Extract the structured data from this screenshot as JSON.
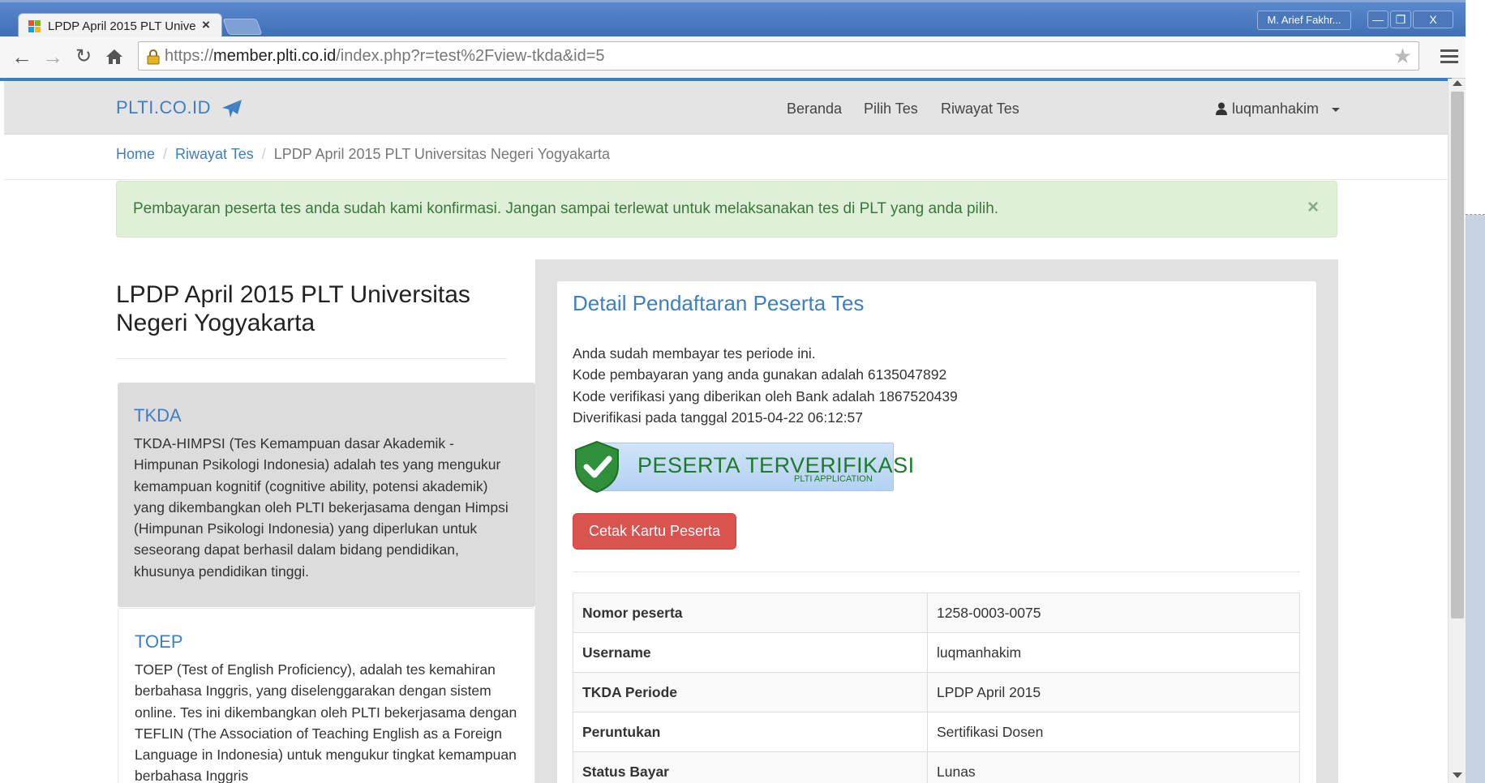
{
  "browser": {
    "tab_title": "LPDP April 2015 PLT Universitas Negeri Yogyakarta",
    "tab_close": "×",
    "user_badge": "M. Arief Fakhr...",
    "win_minimize": "—",
    "win_restore": "❐",
    "win_close": "X",
    "url_scheme": "https://",
    "url_host": "member.plti.co.id",
    "url_path": "/index.php?r=test%2Fview-tkda&id=5",
    "icons": [
      "back-icon",
      "forward-icon",
      "reload-icon",
      "home-icon",
      "lock-icon",
      "star-icon",
      "menu-icon"
    ]
  },
  "navbar": {
    "brand": "PLTI.CO.ID",
    "links": [
      "Beranda",
      "Pilih Tes",
      "Riwayat Tes"
    ],
    "user": "luqmanhakim"
  },
  "breadcrumb": {
    "home": "Home",
    "history": "Riwayat Tes",
    "current": "LPDP April 2015 PLT Universitas Negeri Yogyakarta"
  },
  "alert": {
    "text": "Pembayaran peserta tes anda sudah kami konfirmasi. Jangan sampai terlewat untuk melaksanakan tes di PLT yang anda pilih.",
    "close": "×",
    "color": "#dff0d8"
  },
  "left": {
    "title": "LPDP April 2015 PLT Universitas Negeri Yogyakarta",
    "tkda": {
      "heading": "TKDA",
      "body": "TKDA-HIMPSI (Tes Kemampuan dasar Akademik - Himpunan Psikologi Indonesia) adalah tes yang mengukur kemampuan kognitif (cognitive ability, potensi akademik) yang dikembangkan oleh PLTI bekerjasama dengan Himpsi (Himpunan Psikologi Indonesia) yang diperlukan untuk seseorang dapat berhasil dalam bidang pendidikan, khusunya pendidikan tinggi."
    },
    "toep": {
      "heading": "TOEP",
      "body": "TOEP (Test of English Proficiency), adalah tes kemahiran berbahasa Inggris, yang diselenggarakan dengan sistem online. Tes ini dikembangkan oleh PLTI bekerjasama dengan TEFLIN (The Association of Teaching English as a Foreign Language in Indonesia) untuk mengukur tingkat kemampuan berbahasa Inggris"
    }
  },
  "card": {
    "title": "Detail Pendaftaran Peserta Tes",
    "info": [
      "Anda sudah membayar tes periode ini.",
      "Kode pembayaran yang anda gunakan adalah 6135047892",
      "Kode verifikasi yang diberikan oleh Bank adalah 1867520439",
      "Diverifikasi pada tanggal 2015-04-22 06:12:57"
    ],
    "badge_main": "PESERTA TERVERIFIKASI",
    "badge_sub": "PLTI APPLICATION",
    "print_button": "Cetak Kartu Peserta",
    "print_color": "#d9534f",
    "rows": [
      {
        "key": "Nomor peserta",
        "value": "1258-0003-0075"
      },
      {
        "key": "Username",
        "value": "luqmanhakim"
      },
      {
        "key": "TKDA Periode",
        "value": "LPDP April 2015"
      },
      {
        "key": "Peruntukan",
        "value": "Sertifikasi Dosen"
      },
      {
        "key": "Status Bayar",
        "value": "Lunas"
      }
    ]
  }
}
